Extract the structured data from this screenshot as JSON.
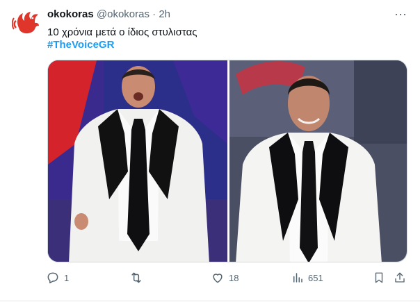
{
  "tweet": {
    "display_name": "okokoras",
    "handle": "@okokoras",
    "separator": "·",
    "time": "2h",
    "text": "10 χρόνια μετά ο ίδιος στυλιστας",
    "hashtag": "#TheVoiceGR",
    "more_label": "···",
    "avatar_icon": "rooster-logo-icon",
    "media": {
      "images": [
        {
          "name": "left-photo",
          "description_icon": "man-white-tuxedo-image"
        },
        {
          "name": "right-photo",
          "description_icon": "man-white-tuxedo-image"
        }
      ]
    },
    "actions": {
      "reply_count": "1",
      "retweet_count": "",
      "like_count": "18",
      "views_count": "651"
    }
  },
  "colors": {
    "accent": "#1d9bf0",
    "text": "#0f1419",
    "muted": "#536471",
    "logo_red": "#e0352b"
  }
}
